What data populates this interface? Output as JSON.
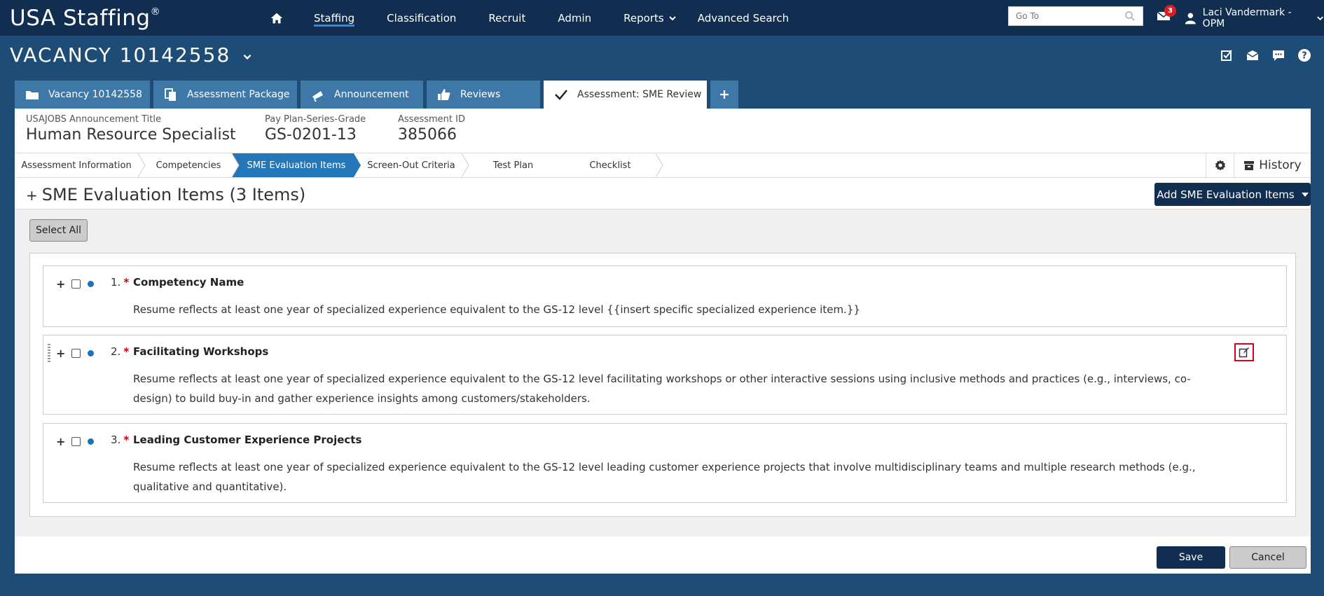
{
  "app": {
    "brand": "USA Staffing",
    "brand_mark": "®"
  },
  "nav": {
    "items": [
      "Staffing",
      "Classification",
      "Recruit",
      "Admin",
      "Reports",
      "Advanced Search"
    ],
    "active": "Staffing",
    "goto_placeholder": "Go To",
    "mail_count": "3",
    "user_name": "Laci Vandermark - OPM"
  },
  "vacancy": {
    "title": "VACANCY 10142558"
  },
  "tabs": [
    {
      "label": "Vacancy 10142558",
      "icon": "folder-icon"
    },
    {
      "label": "Assessment Package",
      "icon": "documents-icon"
    },
    {
      "label": "Announcement",
      "icon": "megaphone-icon"
    },
    {
      "label": "Reviews",
      "icon": "thumbs-up-icon"
    },
    {
      "label": "Assessment: SME Review",
      "icon": "checkmark-icon"
    }
  ],
  "meta": {
    "announcement_label": "USAJOBS Announcement Title",
    "announcement_value": "Human Resource Specialist",
    "grade_label": "Pay Plan-Series-Grade",
    "grade_value": "GS-0201-13",
    "assessment_label": "Assessment ID",
    "assessment_value": "385066"
  },
  "steps": [
    "Assessment Information",
    "Competencies",
    "SME Evaluation Items",
    "Screen-Out Criteria",
    "Test Plan",
    "Checklist"
  ],
  "active_step": "SME Evaluation Items",
  "history_label": "History",
  "section": {
    "title": "SME Evaluation Items (3 Items)",
    "expand": "+",
    "add_button": "Add SME Evaluation Items",
    "select_all": "Select All"
  },
  "items": [
    {
      "num": "1.",
      "name": "Competency Name",
      "desc": "Resume reflects at least one year of specialized experience equivalent to the GS-12 level {{insert specific specialized experience item.}}"
    },
    {
      "num": "2.",
      "name": "Facilitating Workshops",
      "desc": "Resume reflects at least one year of specialized experience equivalent to the GS-12 level facilitating workshops or other interactive sessions using inclusive methods and practices (e.g., interviews, co-design) to build buy-in and gather experience insights among customers/stakeholders."
    },
    {
      "num": "3.",
      "name": "Leading Customer Experience Projects",
      "desc": "Resume reflects at least one year of specialized experience equivalent to the GS-12 level leading customer experience projects that involve multidisciplinary teams and multiple research methods (e.g., qualitative and quantitative)."
    }
  ],
  "footer": {
    "save": "Save",
    "cancel": "Cancel"
  },
  "colors": {
    "navy": "#112e51",
    "active_step": "#2377b8",
    "tab": "#3e78a8",
    "required": "#cc0000",
    "highlight": "#d0021b"
  }
}
